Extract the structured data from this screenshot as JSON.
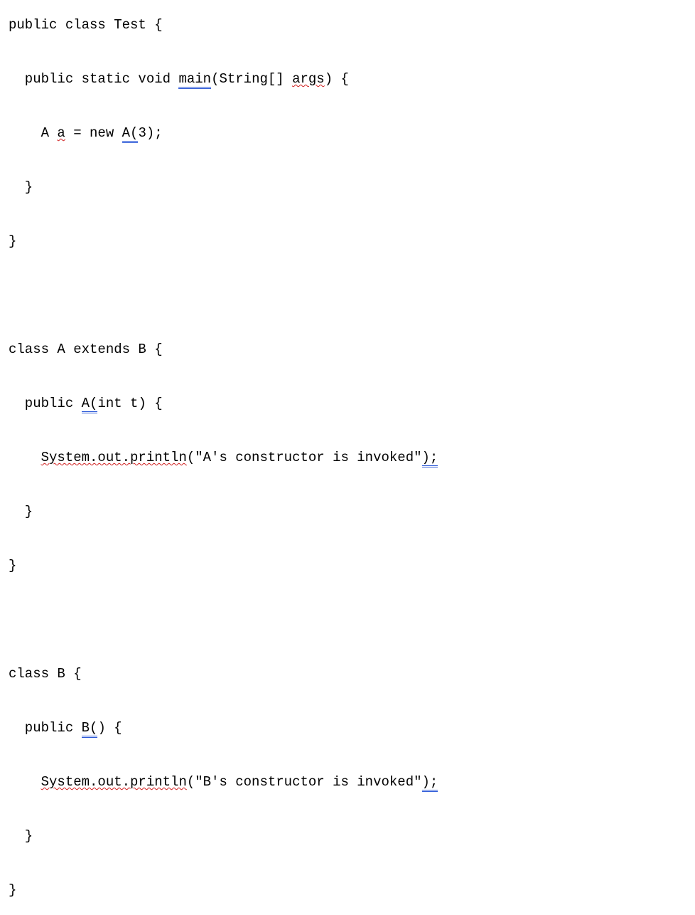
{
  "code": {
    "l01_a": "public class Test {",
    "l02_a": "  public static void ",
    "l02_b": "main",
    "l02_c": "(String[] ",
    "l02_d": "args",
    "l02_e": ") {",
    "l03_a": "    A ",
    "l03_b": "a",
    "l03_c": " = new ",
    "l03_d": "A(",
    "l03_e": "3);",
    "l04_a": "  }",
    "l05_a": "}",
    "l06_a": "class A extends B {",
    "l07_a": "  public ",
    "l07_b": "A(",
    "l07_c": "int t) {",
    "l08_a": "    ",
    "l08_b": "System.out.println",
    "l08_c": "(\"A's constructor is invoked\"",
    "l08_d": ");",
    "l09_a": "  }",
    "l10_a": "}",
    "l11_a": "class B {",
    "l12_a": "  public ",
    "l12_b": "B(",
    "l12_c": ") {",
    "l13_a": "    ",
    "l13_b": "System.out.println",
    "l13_c": "(\"B's constructor is invoked\"",
    "l13_d": ");",
    "l14_a": "  }",
    "l15_a": "}"
  }
}
